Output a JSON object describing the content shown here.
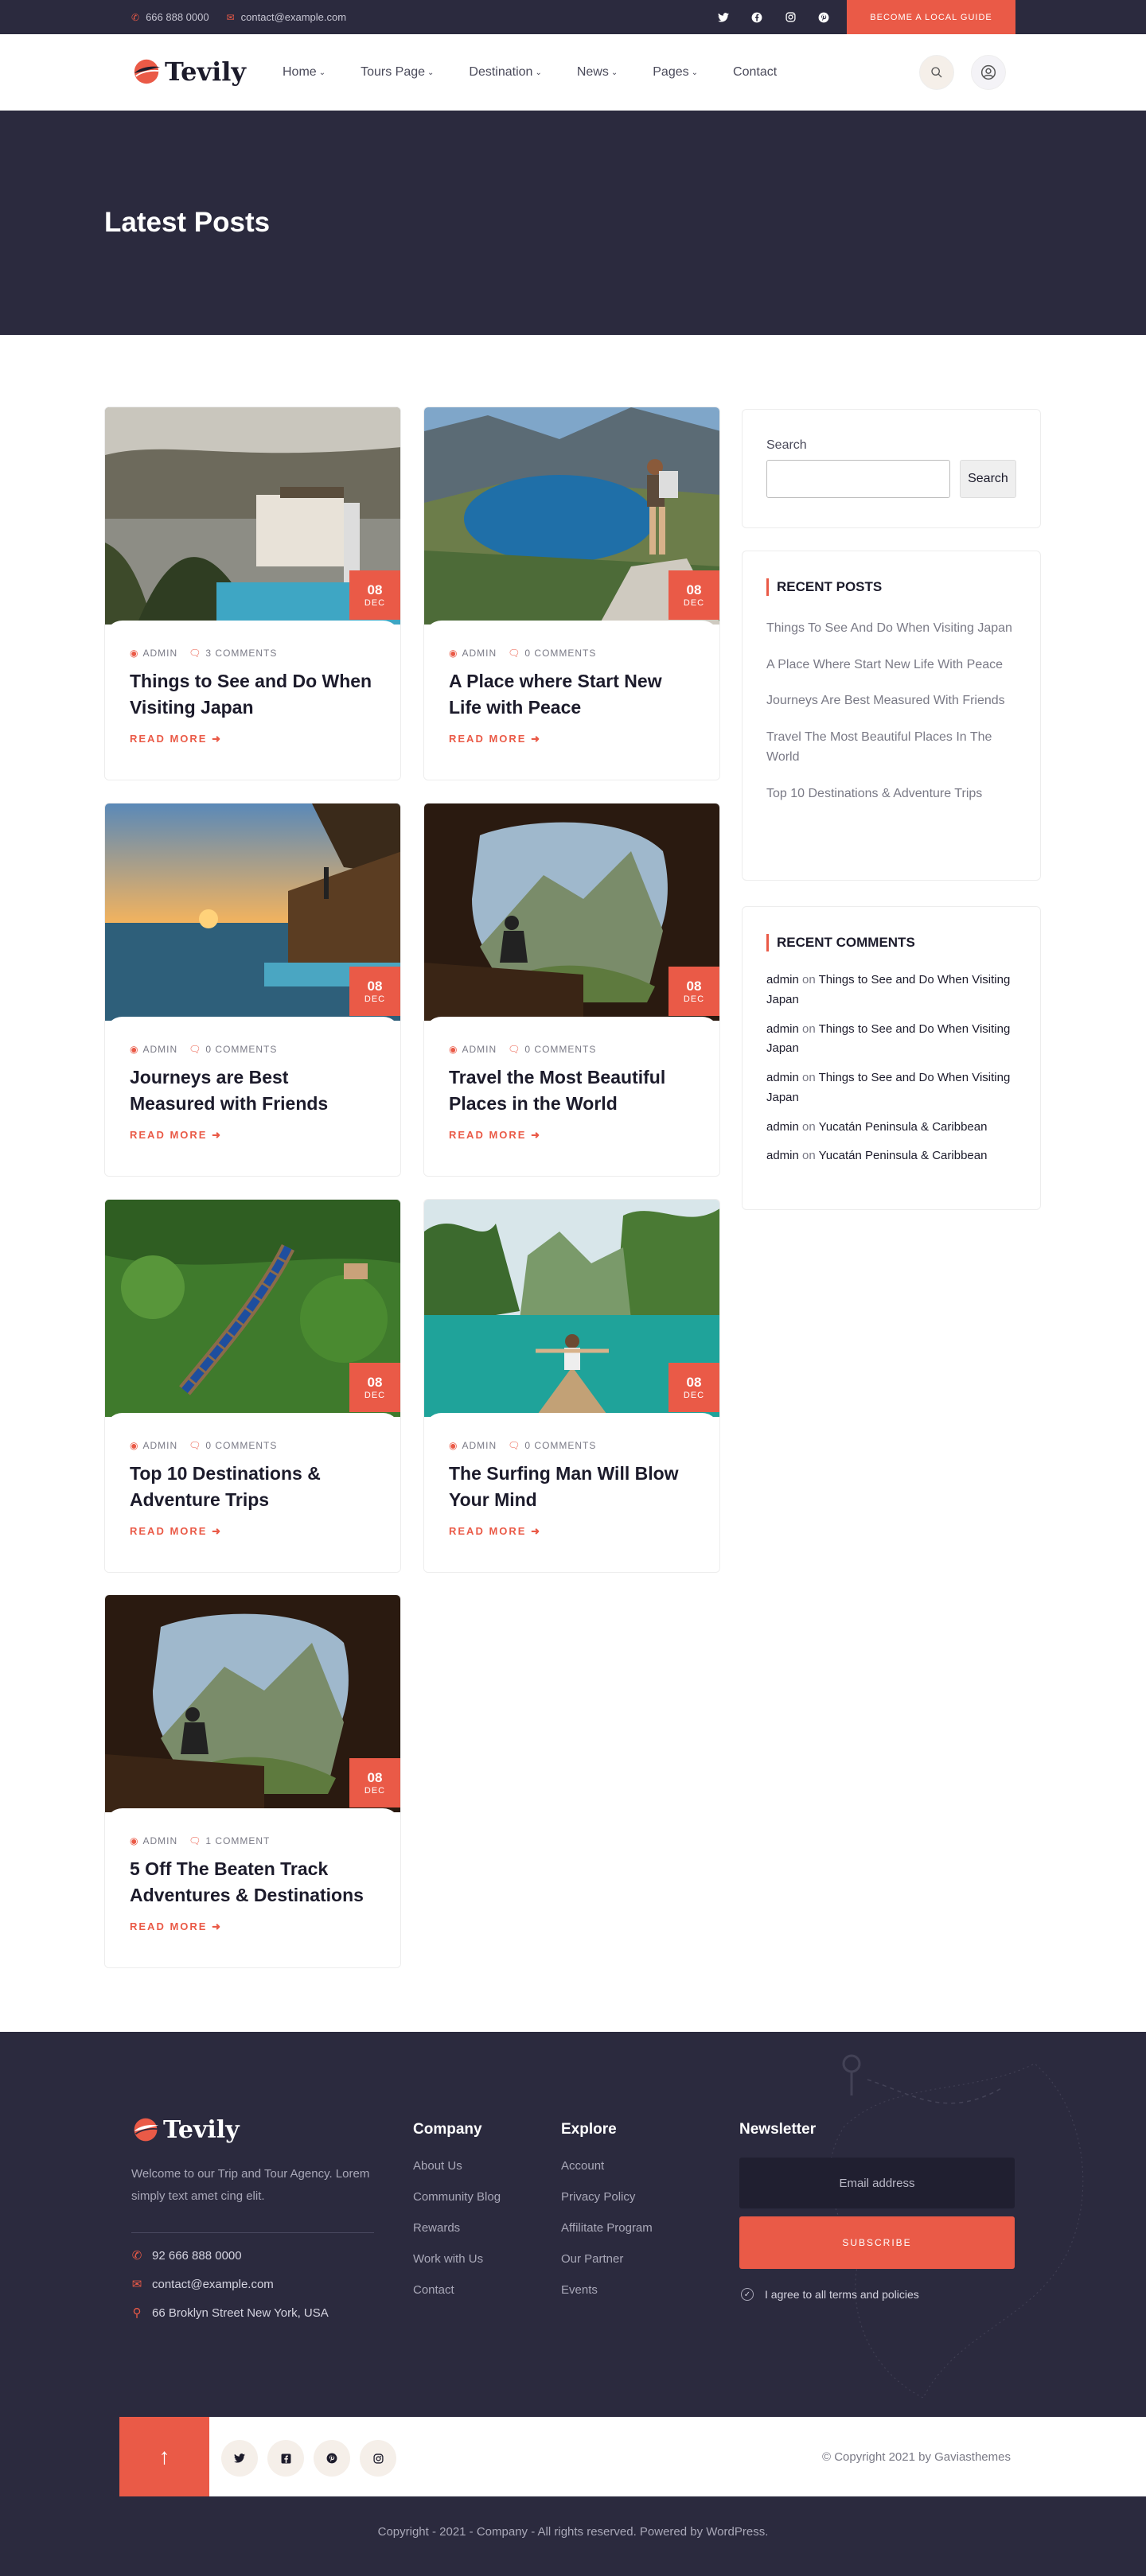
{
  "topbar": {
    "phone": "666 888 0000",
    "email": "contact@example.com",
    "guide_button": "Become A Local Guide"
  },
  "header": {
    "logo": "Tevily",
    "nav": [
      {
        "label": "Home",
        "dropdown": true
      },
      {
        "label": "Tours Page",
        "dropdown": true
      },
      {
        "label": "Destination",
        "dropdown": true
      },
      {
        "label": "News",
        "dropdown": true
      },
      {
        "label": "Pages",
        "dropdown": true
      },
      {
        "label": "Contact",
        "dropdown": false
      }
    ]
  },
  "page_title": "Latest Posts",
  "posts": [
    {
      "day": "08",
      "month": "DEC",
      "author": "ADMIN",
      "comments": "3 COMMENTS",
      "title": "Things to See and Do When Visiting Japan",
      "more": "READ MORE"
    },
    {
      "day": "08",
      "month": "DEC",
      "author": "ADMIN",
      "comments": "0 COMMENTS",
      "title": "A Place where Start New Life with Peace",
      "more": "READ MORE"
    },
    {
      "day": "08",
      "month": "DEC",
      "author": "ADMIN",
      "comments": "0 COMMENTS",
      "title": "Journeys are Best Measured with Friends",
      "more": "READ MORE"
    },
    {
      "day": "08",
      "month": "DEC",
      "author": "ADMIN",
      "comments": "0 COMMENTS",
      "title": "Travel the Most Beautiful Places in the World",
      "more": "READ MORE"
    },
    {
      "day": "08",
      "month": "DEC",
      "author": "ADMIN",
      "comments": "0 COMMENTS",
      "title": "Top 10 Destinations & Adventure Trips",
      "more": "READ MORE"
    },
    {
      "day": "08",
      "month": "DEC",
      "author": "ADMIN",
      "comments": "0 COMMENTS",
      "title": "The Surfing Man Will Blow Your Mind",
      "more": "READ MORE"
    },
    {
      "day": "08",
      "month": "DEC",
      "author": "ADMIN",
      "comments": "1 COMMENT",
      "title": "5 Off The Beaten Track Adventures & Destinations",
      "more": "READ MORE"
    }
  ],
  "sidebar": {
    "search_label": "Search",
    "search_button": "Search",
    "recent_posts_title": "RECENT POSTS",
    "recent_posts": [
      "Things To See And Do When Visiting Japan",
      "A Place Where Start New Life With Peace",
      "Journeys Are Best Measured With Friends",
      "Travel The Most Beautiful Places In The World",
      "Top 10 Destinations & Adventure Trips"
    ],
    "recent_comments_title": "RECENT COMMENTS",
    "recent_comments": [
      {
        "author": "admin",
        "on": "on",
        "post": "Things to See and Do When Visiting Japan"
      },
      {
        "author": "admin",
        "on": "on",
        "post": "Things to See and Do When Visiting Japan"
      },
      {
        "author": "admin",
        "on": "on",
        "post": "Things to See and Do When Visiting Japan"
      },
      {
        "author": "admin",
        "on": "on",
        "post": "Yucatán Peninsula & Caribbean"
      },
      {
        "author": "admin",
        "on": "on",
        "post": "Yucatán Peninsula & Caribbean"
      }
    ]
  },
  "footer": {
    "logo": "Tevily",
    "about": "Welcome to our Trip and Tour Agency. Lorem simply text amet cing elit.",
    "phone": "92 666 888 0000",
    "email": "contact@example.com",
    "address": "66 Broklyn Street New York, USA",
    "company_title": "Company",
    "company_links": [
      "About Us",
      "Community Blog",
      "Rewards",
      "Work with Us",
      "Contact"
    ],
    "explore_title": "Explore",
    "explore_links": [
      "Account",
      "Privacy Policy",
      "Affilitate Program",
      "Our Partner",
      "Events"
    ],
    "newsletter_title": "Newsletter",
    "email_placeholder": "Email address",
    "subscribe": "Subscribe",
    "agree": "I agree to all terms and policies",
    "copyright": "© Copyright 2021 by Gaviasthemes",
    "bottom": "Copyright - 2021 - Company - All rights reserved. Powered by WordPress."
  },
  "colors": {
    "accent": "#ea5a47",
    "dark": "#2b2a3e"
  }
}
